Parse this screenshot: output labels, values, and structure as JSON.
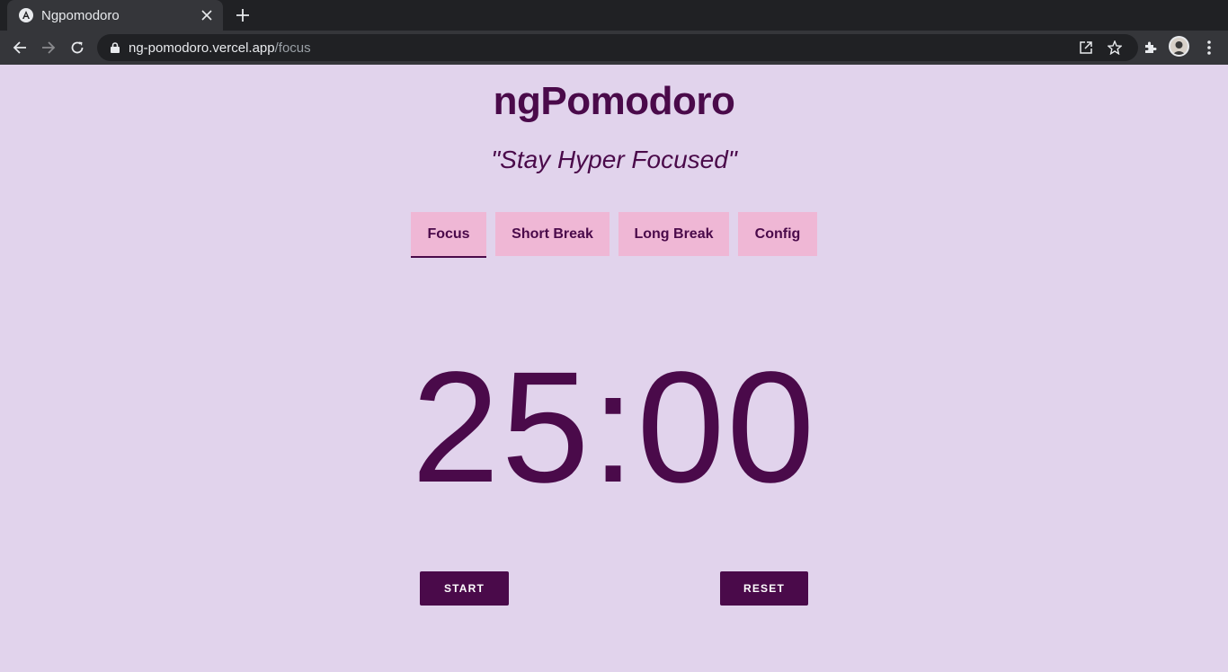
{
  "browser": {
    "tab_title": "Ngpomodoro",
    "url_host": "ng-pomodoro.vercel.app",
    "url_path": "/focus",
    "icons": [
      "angular-favicon-icon",
      "close-icon",
      "plus-icon",
      "back-arrow-icon",
      "forward-arrow-icon",
      "reload-icon",
      "lock-icon",
      "open-external-icon",
      "star-icon",
      "extensions-icon",
      "avatar",
      "kebab-menu-icon"
    ]
  },
  "app": {
    "title": "ngPomodoro",
    "tagline": "\"Stay Hyper Focused\"",
    "tabs": [
      {
        "label": "Focus",
        "active": true
      },
      {
        "label": "Short Break",
        "active": false
      },
      {
        "label": "Long Break",
        "active": false
      },
      {
        "label": "Config",
        "active": false
      }
    ],
    "timer": "25:00",
    "start_label": "START",
    "reset_label": "RESET"
  },
  "colors": {
    "background": "#e1d3ec",
    "primary": "#4a0a4a",
    "tab_bg": "#efb7d5",
    "button_text": "#ffffff"
  }
}
